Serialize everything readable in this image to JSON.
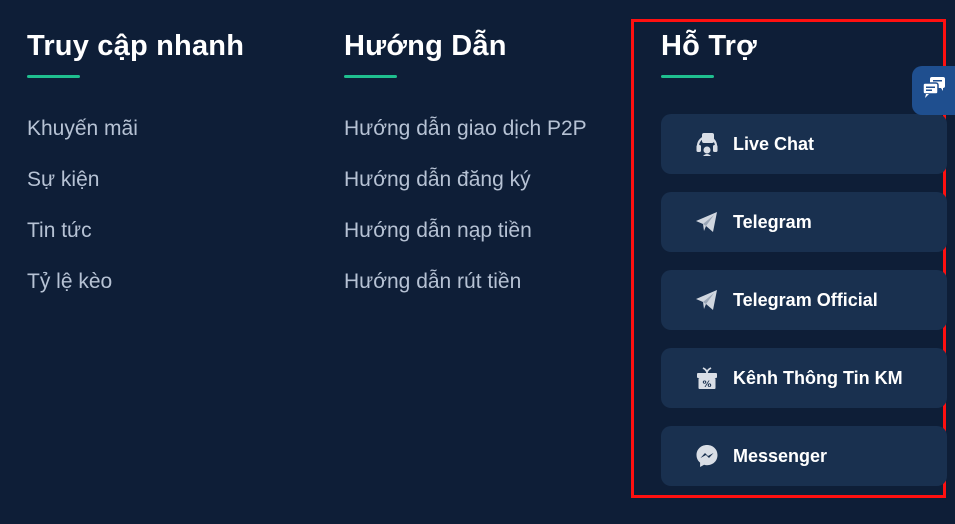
{
  "quick_access": {
    "title": "Truy cập nhanh",
    "links": [
      "Khuyến mãi",
      "Sự kiện",
      "Tin tức",
      "Tỷ lệ kèo"
    ]
  },
  "guide": {
    "title": "Hướng Dẫn",
    "links": [
      "Hướng dẫn giao dịch P2P",
      "Hướng dẫn đăng ký",
      "Hướng dẫn nạp tiền",
      "Hướng dẫn rút tiền"
    ]
  },
  "support": {
    "title": "Hỗ Trợ",
    "items": [
      {
        "label": "Live Chat",
        "icon": "headset-icon"
      },
      {
        "label": "Telegram",
        "icon": "telegram-icon"
      },
      {
        "label": "Telegram Official",
        "icon": "telegram-icon"
      },
      {
        "label": "Kênh Thông Tin KM",
        "icon": "gift-percent-icon"
      },
      {
        "label": "Messenger",
        "icon": "messenger-icon"
      }
    ]
  },
  "floating_chat": {
    "icon": "chat-bubbles-icon"
  },
  "colors": {
    "background": "#0e1e37",
    "card": "#19304f",
    "accent_underline": "#1fbf8f",
    "highlight_frame": "#ff1010",
    "link_text": "#b6c2d4"
  }
}
